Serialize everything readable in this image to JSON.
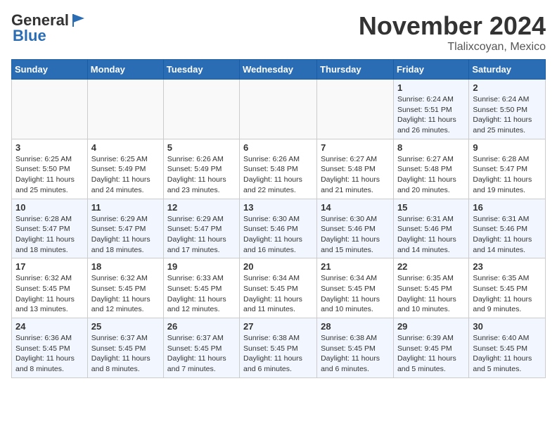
{
  "logo": {
    "general": "General",
    "blue": "Blue"
  },
  "title": "November 2024",
  "location": "Tlalixcoyan, Mexico",
  "weekdays": [
    "Sunday",
    "Monday",
    "Tuesday",
    "Wednesday",
    "Thursday",
    "Friday",
    "Saturday"
  ],
  "weeks": [
    [
      {
        "day": "",
        "info": ""
      },
      {
        "day": "",
        "info": ""
      },
      {
        "day": "",
        "info": ""
      },
      {
        "day": "",
        "info": ""
      },
      {
        "day": "",
        "info": ""
      },
      {
        "day": "1",
        "info": "Sunrise: 6:24 AM\nSunset: 5:51 PM\nDaylight: 11 hours and 26 minutes."
      },
      {
        "day": "2",
        "info": "Sunrise: 6:24 AM\nSunset: 5:50 PM\nDaylight: 11 hours and 25 minutes."
      }
    ],
    [
      {
        "day": "3",
        "info": "Sunrise: 6:25 AM\nSunset: 5:50 PM\nDaylight: 11 hours and 25 minutes."
      },
      {
        "day": "4",
        "info": "Sunrise: 6:25 AM\nSunset: 5:49 PM\nDaylight: 11 hours and 24 minutes."
      },
      {
        "day": "5",
        "info": "Sunrise: 6:26 AM\nSunset: 5:49 PM\nDaylight: 11 hours and 23 minutes."
      },
      {
        "day": "6",
        "info": "Sunrise: 6:26 AM\nSunset: 5:48 PM\nDaylight: 11 hours and 22 minutes."
      },
      {
        "day": "7",
        "info": "Sunrise: 6:27 AM\nSunset: 5:48 PM\nDaylight: 11 hours and 21 minutes."
      },
      {
        "day": "8",
        "info": "Sunrise: 6:27 AM\nSunset: 5:48 PM\nDaylight: 11 hours and 20 minutes."
      },
      {
        "day": "9",
        "info": "Sunrise: 6:28 AM\nSunset: 5:47 PM\nDaylight: 11 hours and 19 minutes."
      }
    ],
    [
      {
        "day": "10",
        "info": "Sunrise: 6:28 AM\nSunset: 5:47 PM\nDaylight: 11 hours and 18 minutes."
      },
      {
        "day": "11",
        "info": "Sunrise: 6:29 AM\nSunset: 5:47 PM\nDaylight: 11 hours and 18 minutes."
      },
      {
        "day": "12",
        "info": "Sunrise: 6:29 AM\nSunset: 5:47 PM\nDaylight: 11 hours and 17 minutes."
      },
      {
        "day": "13",
        "info": "Sunrise: 6:30 AM\nSunset: 5:46 PM\nDaylight: 11 hours and 16 minutes."
      },
      {
        "day": "14",
        "info": "Sunrise: 6:30 AM\nSunset: 5:46 PM\nDaylight: 11 hours and 15 minutes."
      },
      {
        "day": "15",
        "info": "Sunrise: 6:31 AM\nSunset: 5:46 PM\nDaylight: 11 hours and 14 minutes."
      },
      {
        "day": "16",
        "info": "Sunrise: 6:31 AM\nSunset: 5:46 PM\nDaylight: 11 hours and 14 minutes."
      }
    ],
    [
      {
        "day": "17",
        "info": "Sunrise: 6:32 AM\nSunset: 5:45 PM\nDaylight: 11 hours and 13 minutes."
      },
      {
        "day": "18",
        "info": "Sunrise: 6:32 AM\nSunset: 5:45 PM\nDaylight: 11 hours and 12 minutes."
      },
      {
        "day": "19",
        "info": "Sunrise: 6:33 AM\nSunset: 5:45 PM\nDaylight: 11 hours and 12 minutes."
      },
      {
        "day": "20",
        "info": "Sunrise: 6:34 AM\nSunset: 5:45 PM\nDaylight: 11 hours and 11 minutes."
      },
      {
        "day": "21",
        "info": "Sunrise: 6:34 AM\nSunset: 5:45 PM\nDaylight: 11 hours and 10 minutes."
      },
      {
        "day": "22",
        "info": "Sunrise: 6:35 AM\nSunset: 5:45 PM\nDaylight: 11 hours and 10 minutes."
      },
      {
        "day": "23",
        "info": "Sunrise: 6:35 AM\nSunset: 5:45 PM\nDaylight: 11 hours and 9 minutes."
      }
    ],
    [
      {
        "day": "24",
        "info": "Sunrise: 6:36 AM\nSunset: 5:45 PM\nDaylight: 11 hours and 8 minutes."
      },
      {
        "day": "25",
        "info": "Sunrise: 6:37 AM\nSunset: 5:45 PM\nDaylight: 11 hours and 8 minutes."
      },
      {
        "day": "26",
        "info": "Sunrise: 6:37 AM\nSunset: 5:45 PM\nDaylight: 11 hours and 7 minutes."
      },
      {
        "day": "27",
        "info": "Sunrise: 6:38 AM\nSunset: 5:45 PM\nDaylight: 11 hours and 6 minutes."
      },
      {
        "day": "28",
        "info": "Sunrise: 6:38 AM\nSunset: 5:45 PM\nDaylight: 11 hours and 6 minutes."
      },
      {
        "day": "29",
        "info": "Sunrise: 6:39 AM\nSunset: 9:45 PM\nDaylight: 11 hours and 5 minutes."
      },
      {
        "day": "30",
        "info": "Sunrise: 6:40 AM\nSunset: 5:45 PM\nDaylight: 11 hours and 5 minutes."
      }
    ]
  ]
}
